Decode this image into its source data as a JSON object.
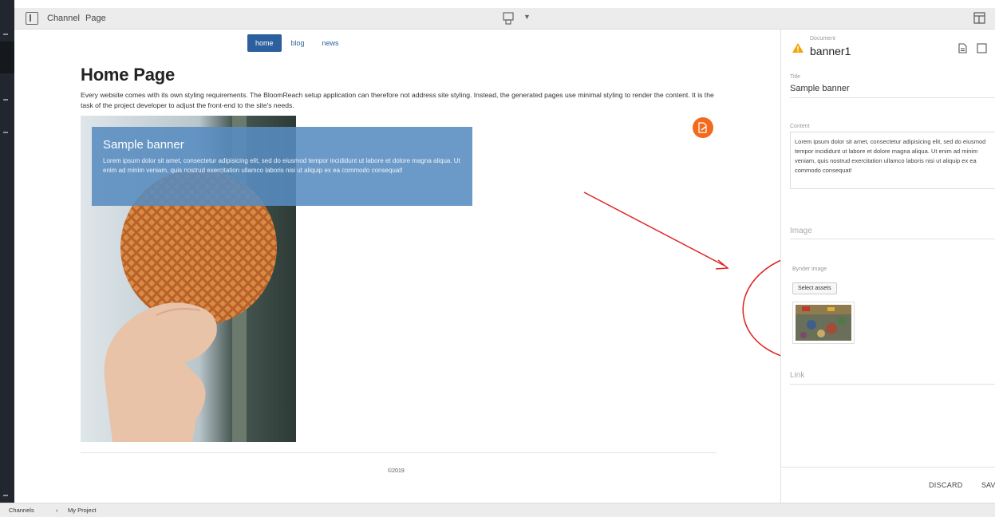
{
  "toolbar": {
    "channel_label": "Channel",
    "page_label": "Page",
    "device_icon": "device-preview-icon",
    "layout_icon": "layout-toggle-icon"
  },
  "nav": {
    "items": [
      {
        "label": "home",
        "active": true
      },
      {
        "label": "blog",
        "active": false
      },
      {
        "label": "news",
        "active": false
      }
    ]
  },
  "page": {
    "title": "Home Page",
    "intro": "Every website comes with its own styling requirements. The BloomReach setup application can therefore not address site styling. Instead, the generated pages use minimal styling to render the content. It is the task of the project developer to adjust the front-end to the site's needs.",
    "banner_title": "Sample banner",
    "banner_text": "Lorem ipsum dolor sit amet, consectetur adipisicing elit, sed do eiusmod tempor incididunt ut labore et dolore magna aliqua. Ut enim ad minim veniam, quis nostrud exercitation ullamco laboris nisi ut aliquip ex ea commodo consequat!",
    "copyright": "©2019"
  },
  "document": {
    "type_label": "Document",
    "name": "banner1",
    "title_label": "Title",
    "title_value": "Sample banner",
    "content_label": "Content",
    "content_value": "Lorem ipsum dolor sit amet, consectetur adipisicing elit, sed do eiusmod tempor incididunt ut labore et dolore magna aliqua. Ut enim ad minim veniam, quis nostrud exercitation ullamco laboris nisi ut aliquip ex ea commodo consequat!",
    "image_label": "Image",
    "bynder_label": "Bynder image",
    "select_assets": "Select assets",
    "link_label": "Link",
    "discard": "DISCARD",
    "save": "SAVE"
  },
  "breadcrumb": {
    "root": "Channels",
    "separator": "›",
    "current": "My Project"
  },
  "colors": {
    "accent_blue": "#2b5f9e",
    "banner_overlay": "#588cc0",
    "fab_orange": "#f26a1b",
    "warning": "#f0a500",
    "annotation_red": "#e02020"
  }
}
